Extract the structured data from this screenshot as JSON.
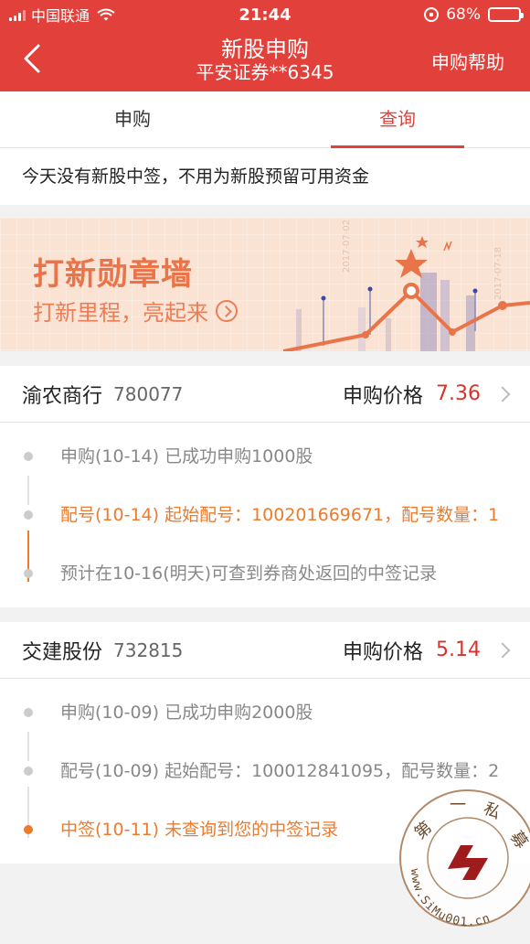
{
  "status_bar": {
    "carrier": "中国联通",
    "time": "21:44",
    "battery_percent": "68%",
    "battery_level": 0.68
  },
  "nav": {
    "title": "新股申购",
    "subtitle": "平安证券**6345",
    "help": "申购帮助"
  },
  "tabs": [
    {
      "label": "申购",
      "active": false
    },
    {
      "label": "查询",
      "active": true
    }
  ],
  "notice": "今天没有新股中签，不用为新股预留可用资金",
  "banner": {
    "title": "打新勋章墙",
    "subtitle": "打新里程，亮起来",
    "dates": [
      "2017-07-02",
      "2017-07-18"
    ]
  },
  "cards": [
    {
      "name": "渝农商行",
      "code": "780077",
      "price_label": "申购价格",
      "price": "7.36",
      "steps": [
        {
          "text": "申购(10-14) 已成功申购1000股",
          "highlight": false
        },
        {
          "text": "配号(10-14) 起始配号：100201669671，配号数量：1",
          "highlight": true
        },
        {
          "text": "预计在10-16(明天)可查到券商处返回的中签记录",
          "highlight": false
        }
      ]
    },
    {
      "name": "交建股份",
      "code": "732815",
      "price_label": "申购价格",
      "price": "5.14",
      "steps": [
        {
          "text": "申购(10-09) 已成功申购2000股",
          "highlight": false
        },
        {
          "text": "配号(10-09) 起始配号：100012841095，配号数量：2",
          "highlight": false
        },
        {
          "text": "中签(10-11) 未查询到您的中签记录",
          "highlight": true
        }
      ]
    }
  ],
  "watermark": {
    "chars": [
      "第",
      "一",
      "私",
      "募"
    ],
    "url": "www.SiMu001.cn"
  },
  "colors": {
    "brand_red": "#e2413b",
    "price_red": "#d9322b",
    "highlight_orange": "#ec7b2d"
  }
}
